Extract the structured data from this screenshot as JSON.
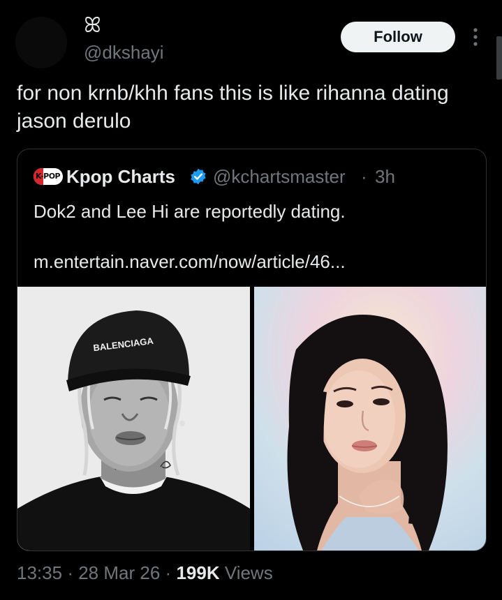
{
  "author": {
    "display_name": "ꕤ",
    "handle": "@dkshayi"
  },
  "follow_label": "Follow",
  "tweet": {
    "text": "for non krnb/khh fans this is like rihanna dating jason derulo"
  },
  "quote": {
    "logo_text": "K-POP",
    "name": "Kpop Charts",
    "handle": "@kchartsmaster",
    "separator": "·",
    "time": "3h",
    "text": "Dok2 and Lee Hi are reportedly dating.",
    "link": "m.entertain.naver.com/now/article/46...",
    "cap_text": "BALENCIAGA"
  },
  "meta": {
    "time": "13:35",
    "dot1": "·",
    "date": "28 Mar 26",
    "dot2": "·",
    "views_count": "199K",
    "views_label": "Views"
  },
  "colors": {
    "background": "#000000",
    "text": "#e7e9ea",
    "secondary": "#71767b",
    "verified": "#1d9bf0",
    "border": "#2f3336"
  },
  "icons": [
    "more-icon",
    "verified-icon"
  ]
}
